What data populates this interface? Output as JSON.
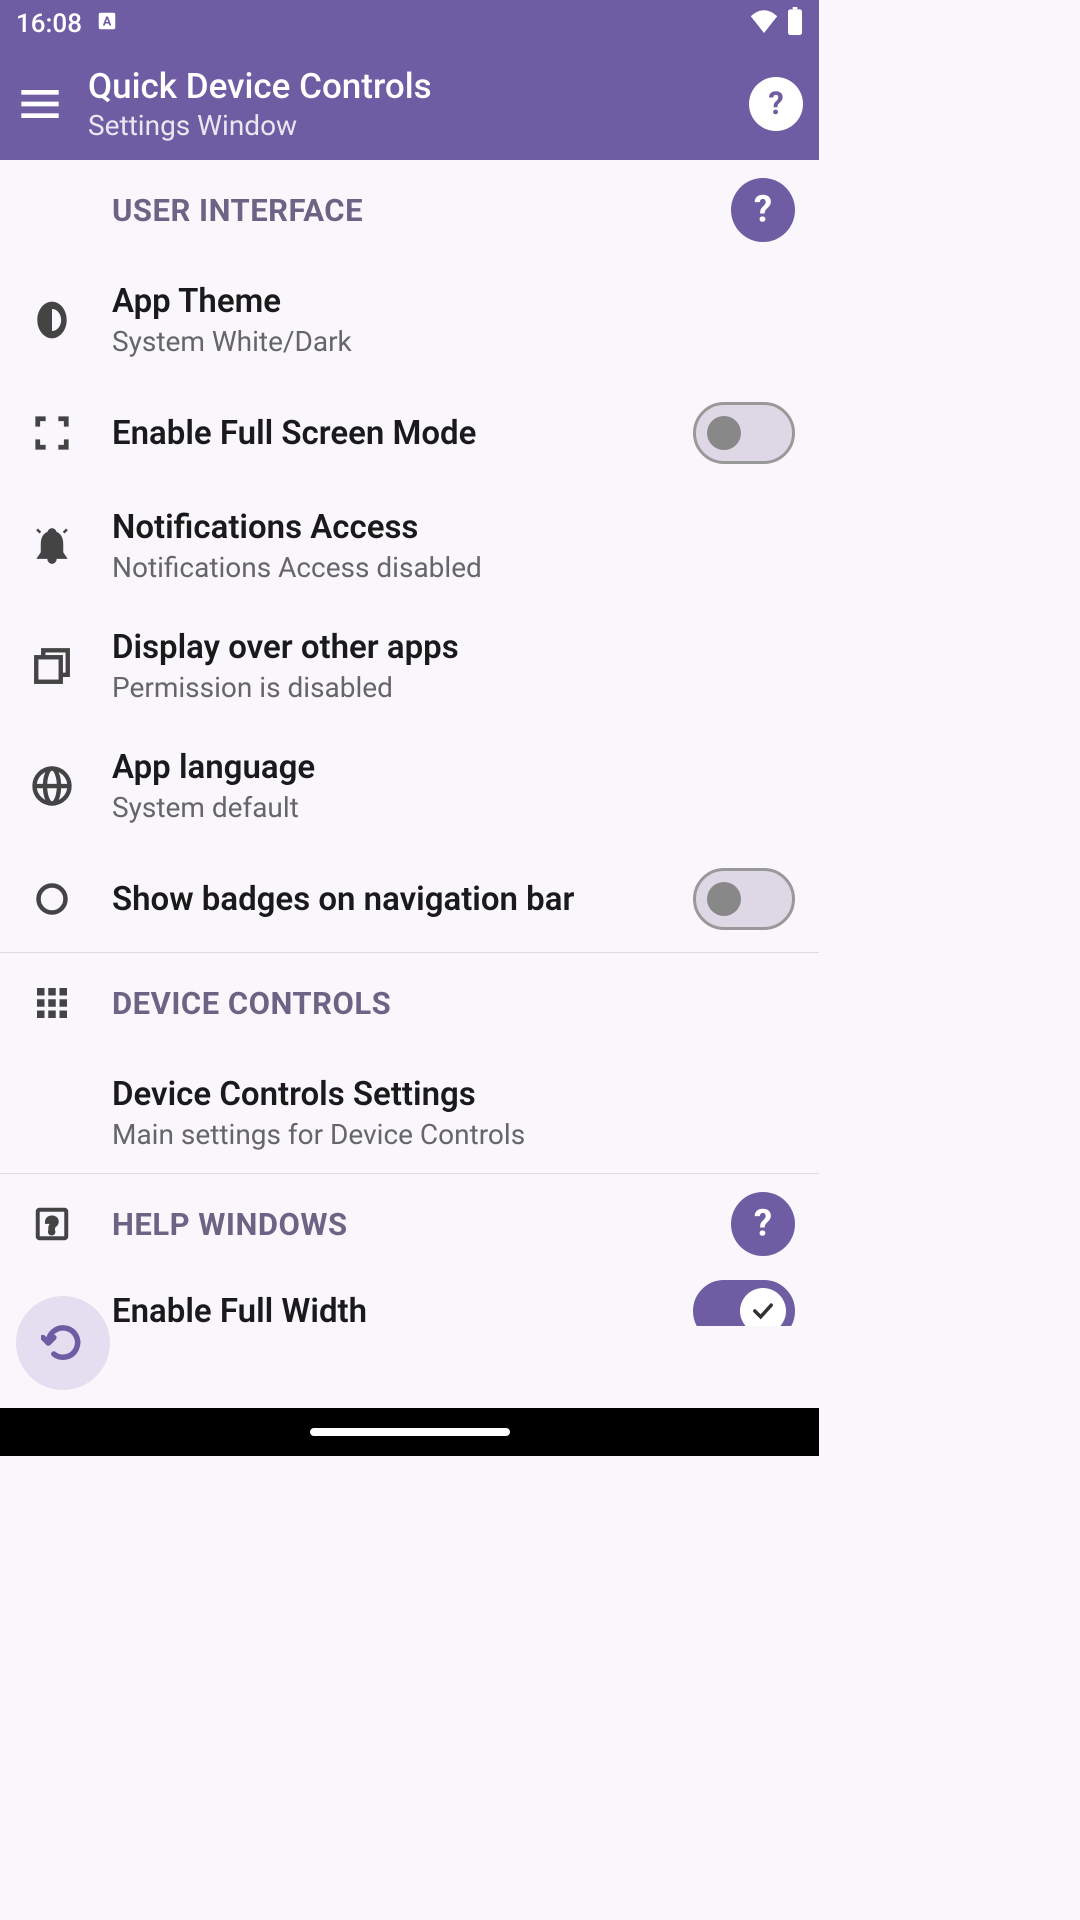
{
  "status_bar": {
    "time": "16:08"
  },
  "header": {
    "title": "Quick Device Controls",
    "subtitle": "Settings Window"
  },
  "sections": {
    "user_interface": {
      "title": "USER INTERFACE",
      "items": {
        "app_theme": {
          "title": "App Theme",
          "subtitle": "System White/Dark"
        },
        "fullscreen": {
          "title": "Enable Full Screen Mode",
          "enabled": false
        },
        "notifications": {
          "title": "Notifications Access",
          "subtitle": "Notifications Access disabled"
        },
        "display_over": {
          "title": "Display over other apps",
          "subtitle": "Permission is disabled"
        },
        "language": {
          "title": "App language",
          "subtitle": "System default"
        },
        "badges": {
          "title": "Show badges on navigation bar",
          "enabled": false
        }
      }
    },
    "device_controls": {
      "title": "DEVICE CONTROLS",
      "items": {
        "settings": {
          "title": "Device Controls Settings",
          "subtitle": "Main settings for Device Controls"
        }
      }
    },
    "help_windows": {
      "title": "HELP WINDOWS",
      "items": {
        "full_width": {
          "title": "Enable Full Width",
          "enabled": true
        }
      }
    }
  }
}
